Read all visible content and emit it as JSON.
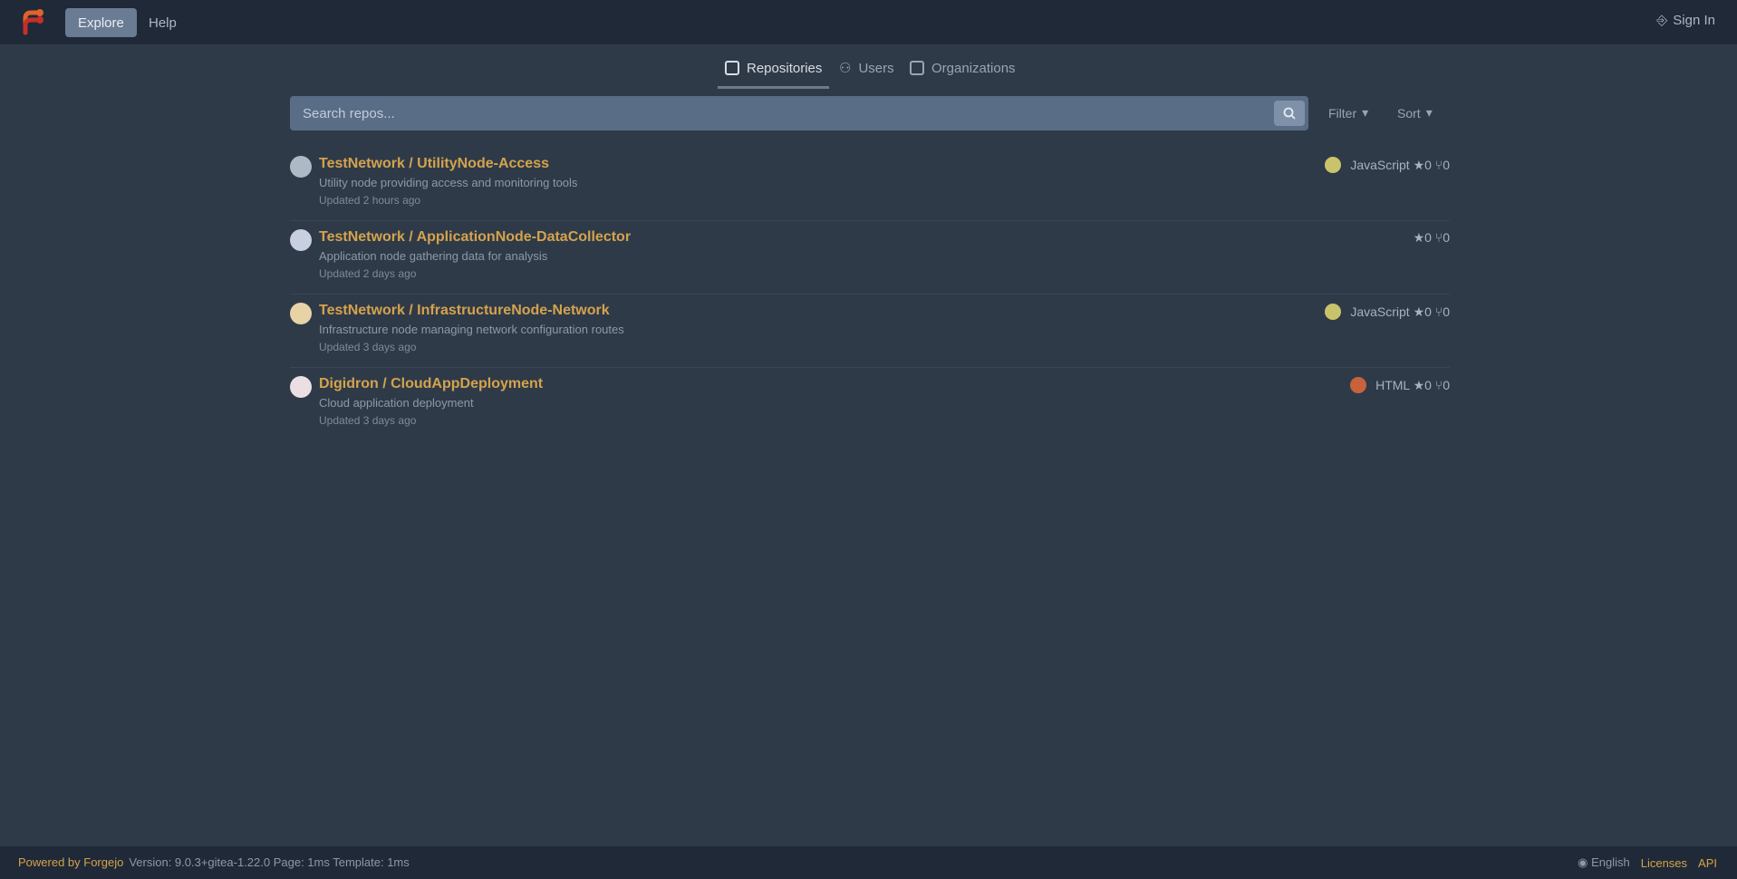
{
  "nav": {
    "items": [
      "Explore",
      "Help"
    ],
    "signin": "Sign In"
  },
  "tabs": [
    {
      "label": "Repositories",
      "icon": "repo-icon"
    },
    {
      "label": "Users",
      "icon": "users-icon"
    },
    {
      "label": "Organizations",
      "icon": "organization-icon"
    }
  ],
  "search": {
    "placeholder": "Search repos...",
    "sort_label": "Filter",
    "filter_label": "Sort"
  },
  "repos": [
    {
      "name": "TestNetwork / UtilityNode-Access",
      "description": "Utility node providing access and monitoring tools",
      "updated": "Updated 2 hours ago",
      "language": "JavaScript",
      "lang_color": "#c9c46b",
      "stats": "JavaScript ★0 ⑂0"
    },
    {
      "name": "TestNetwork / ApplicationNode-DataCollector",
      "description": "Application node gathering data for analysis",
      "updated": "Updated 2 days ago",
      "language": "",
      "lang_color": "#8a95a3",
      "stats": "★0 ⑂0"
    },
    {
      "name": "TestNetwork / InfrastructureNode-Network",
      "description": "Infrastructure node managing network configuration routes",
      "updated": "Updated 3 days ago",
      "language": "JavaScript",
      "lang_color": "#c9c46b",
      "stats": "JavaScript ★0 ⑂0"
    },
    {
      "name": "Digidron / CloudAppDeployment",
      "description": "Cloud application deployment",
      "updated": "Updated 3 days ago",
      "language": "HTML",
      "lang_color": "#c8623d",
      "stats": "HTML ★0 ⑂0"
    }
  ],
  "footer": {
    "brand": "Powered by Forgejo",
    "version": "Version: 9.0.3+gitea-1.22.0 Page: 1ms Template: 1ms",
    "language": "English",
    "licenses": "Licenses",
    "api": "API"
  }
}
